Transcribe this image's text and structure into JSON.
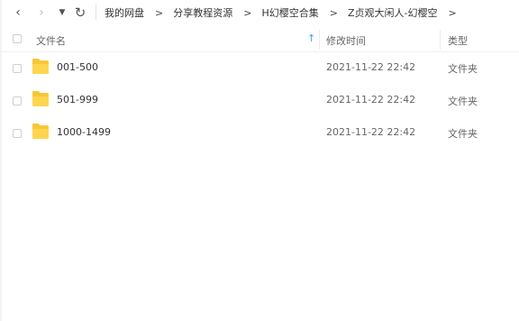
{
  "nav": {
    "back_icon": "chevron-left-icon",
    "forward_icon": "chevron-right-icon",
    "dropdown_icon": "caret-down-icon",
    "refresh_icon": "refresh-icon"
  },
  "breadcrumb": {
    "items": [
      "我的网盘",
      "分享教程资源",
      "H幻樱空合集",
      "Z贞观大闲人-幻樱空"
    ],
    "separator": ">"
  },
  "columns": {
    "name": "文件名",
    "modified": "修改时间",
    "type": "类型",
    "sort_icon": "sort-ascending-icon"
  },
  "files": [
    {
      "name": "001-500",
      "modified": "2021-11-22 22:42",
      "type": "文件夹",
      "icon": "folder-icon"
    },
    {
      "name": "501-999",
      "modified": "2021-11-22 22:42",
      "type": "文件夹",
      "icon": "folder-icon"
    },
    {
      "name": "1000-1499",
      "modified": "2021-11-22 22:42",
      "type": "文件夹",
      "icon": "folder-icon"
    }
  ],
  "colors": {
    "accent": "#3aa0f5",
    "folder": "#ffd54f"
  }
}
